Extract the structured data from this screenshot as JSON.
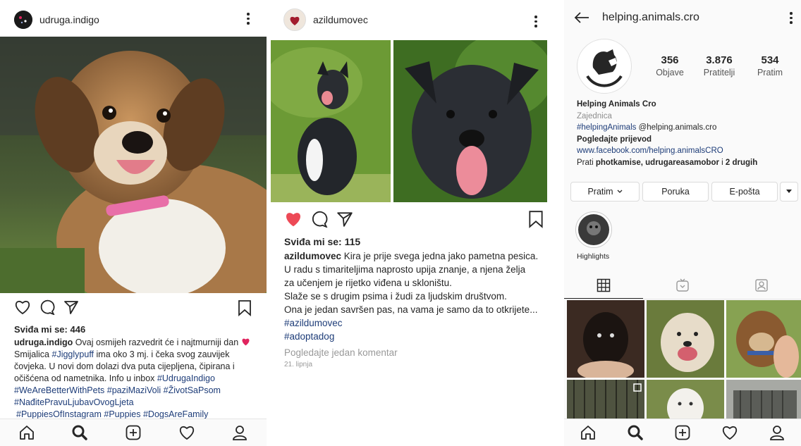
{
  "post1": {
    "username": "udruga.indigo",
    "likes": "Sviđa mi se: 446",
    "caption_user": "udruga.indigo",
    "caption_line1": " Ovaj osmijeh razvedrit će i najtmurniji dan ",
    "caption_line2": "Smijalica ",
    "tag_jiggly": "#Jigglypuff",
    "caption_line2b": " ima oko 3 mj. i čeka svog zauvijek",
    "caption_line3": "čovjeka. U novi dom dolazi dva puta cijepljena, čipirana i",
    "caption_line4": "očišćena od nametnika. Info u inbox ",
    "tag_udruga": "#UdrugaIndigo",
    "tags_line5": "#WeAreBetterWithPets #paziMaziVoli #ŽivotSaPsom",
    "tags_line6": "#NađitePravuLjubavOvogLjeta",
    "tags_line7": "#PuppiesOfInstagram #Puppies #DogsAreFamily",
    "heart_color": "#e0245e"
  },
  "post2": {
    "username": "azildumovec",
    "likes": "Sviđa mi se: 115",
    "caption_user": "azildumovec",
    "caption_line1": " Kira je prije svega jedna jako pametna pesica.",
    "caption_line2": "U radu s timariteljima naprosto upija znanje, a njena želja",
    "caption_line3": "za učenjem je rijetko viđena u skloništu.",
    "caption_line4": "Slaže se s drugim psima i žudi za ljudskim društvom.",
    "caption_line5": "Ona je jedan savršen pas, na vama je samo da to otkrijete...",
    "tag1": "#azildumovec",
    "tag2": "#adoptadog",
    "view_comment": "Pogledajte jedan komentar",
    "date": "21. lipnja",
    "liked_color": "#ed4956"
  },
  "profile": {
    "username": "helping.animals.cro",
    "stats": [
      {
        "value": "356",
        "label": "Objave"
      },
      {
        "value": "3.876",
        "label": "Pratitelji"
      },
      {
        "value": "534",
        "label": "Pratim"
      }
    ],
    "name": "Helping Animals Cro",
    "category": "Zajednica",
    "bio_tag": "#helpingAnimals",
    "bio_mention": " @helping.animals.cro",
    "translate": "Pogledajte prijevod",
    "link": "www.facebook.com/helping.animalsCRO",
    "followed_prefix": "Prati ",
    "followed_names": "photkamise, udrugareasamobor",
    "followed_mid": " i ",
    "followed_more": "2 drugih",
    "buttons": {
      "following": "Pratim",
      "message": "Poruka",
      "email": "E-pošta"
    },
    "highlight_label": "Highlights"
  }
}
